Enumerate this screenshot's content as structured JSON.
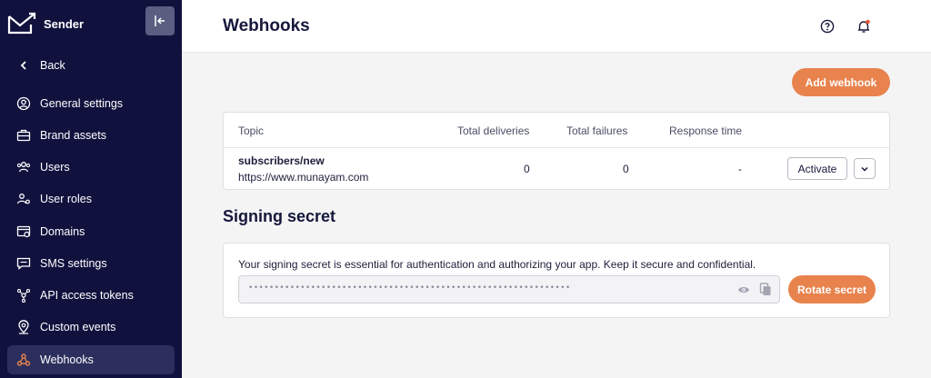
{
  "app": {
    "name": "Sender"
  },
  "sidebar": {
    "back_label": "Back",
    "items": [
      {
        "label": "General settings",
        "icon": "settings-icon"
      },
      {
        "label": "Brand assets",
        "icon": "briefcase-icon"
      },
      {
        "label": "Users",
        "icon": "users-icon"
      },
      {
        "label": "User roles",
        "icon": "user-roles-icon"
      },
      {
        "label": "Domains",
        "icon": "domain-icon"
      },
      {
        "label": "SMS settings",
        "icon": "sms-icon"
      },
      {
        "label": "API access tokens",
        "icon": "api-token-icon"
      },
      {
        "label": "Custom events",
        "icon": "location-pin-icon"
      },
      {
        "label": "Webhooks",
        "icon": "webhook-icon",
        "active": true
      }
    ]
  },
  "header": {
    "title": "Webhooks"
  },
  "actions": {
    "add_webhook": "Add webhook"
  },
  "webhooks_table": {
    "columns": [
      "Topic",
      "Total deliveries",
      "Total failures",
      "Response time"
    ],
    "rows": [
      {
        "topic": "subscribers/new",
        "url": "https://www.munayam.com",
        "deliveries": "0",
        "failures": "0",
        "response_time": "-",
        "action": "Activate"
      }
    ]
  },
  "signing_secret": {
    "title": "Signing secret",
    "description": "Your signing secret is essential for authentication and authorizing your app. Keep it secure and confidential.",
    "masked_value": "••••••••••••••••••••••••••••••••••••••••••••••••••••••••••••••",
    "rotate_label": "Rotate secret"
  },
  "colors": {
    "sidebar_bg": "#11113e",
    "accent": "#e8834d",
    "active_item_bg": "#2c2f5d",
    "notification_dot": "#e8583a"
  }
}
